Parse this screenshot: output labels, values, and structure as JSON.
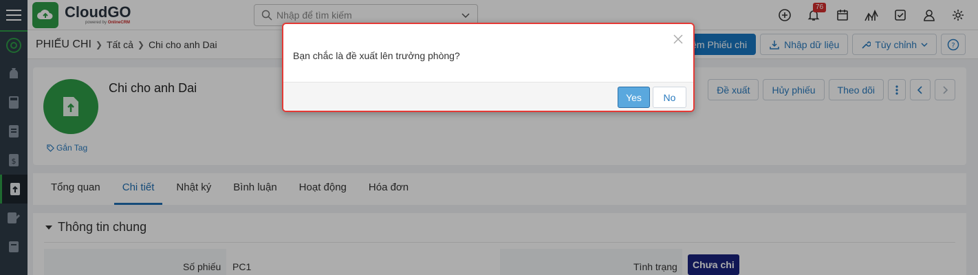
{
  "app": {
    "logo_title": "CloudGO",
    "logo_powered": "powered by",
    "logo_brand": "OnlineCRM"
  },
  "search": {
    "placeholder": "Nhập để tìm kiếm"
  },
  "topbar": {
    "notification_count": "76"
  },
  "breadcrumb": {
    "module": "PHIẾU CHI",
    "level1": "Tất cả",
    "level2": "Chi cho anh Dai"
  },
  "header_actions": {
    "add_label": "Thêm Phiếu chi",
    "import_label": "Nhập dữ liệu",
    "customize_label": "Tùy chỉnh",
    "help_label": "?"
  },
  "record": {
    "title": "Chi cho anh Dai",
    "tag_label": "Gắn Tag",
    "actions": {
      "propose": "Đề xuất",
      "cancel": "Hủy phiếu",
      "follow": "Theo dõi"
    }
  },
  "tabs": [
    "Tổng quan",
    "Chi tiết",
    "Nhật ký",
    "Bình luận",
    "Hoạt động",
    "Hóa đơn"
  ],
  "section": {
    "title": "Thông tin chung",
    "fields": {
      "number_label": "Số phiếu",
      "number_value": "PC1",
      "status_label": "Tình trạng",
      "status_value": "Chưa chi"
    }
  },
  "dialog": {
    "message": "Bạn chắc là đề xuất lên trưởng phòng?",
    "yes_label": "Yes",
    "no_label": "No"
  },
  "colors": {
    "brand_green": "#2e9d48",
    "primary_blue": "#1877c1",
    "status_navy": "#1a237e",
    "dialog_border": "#e53935"
  }
}
